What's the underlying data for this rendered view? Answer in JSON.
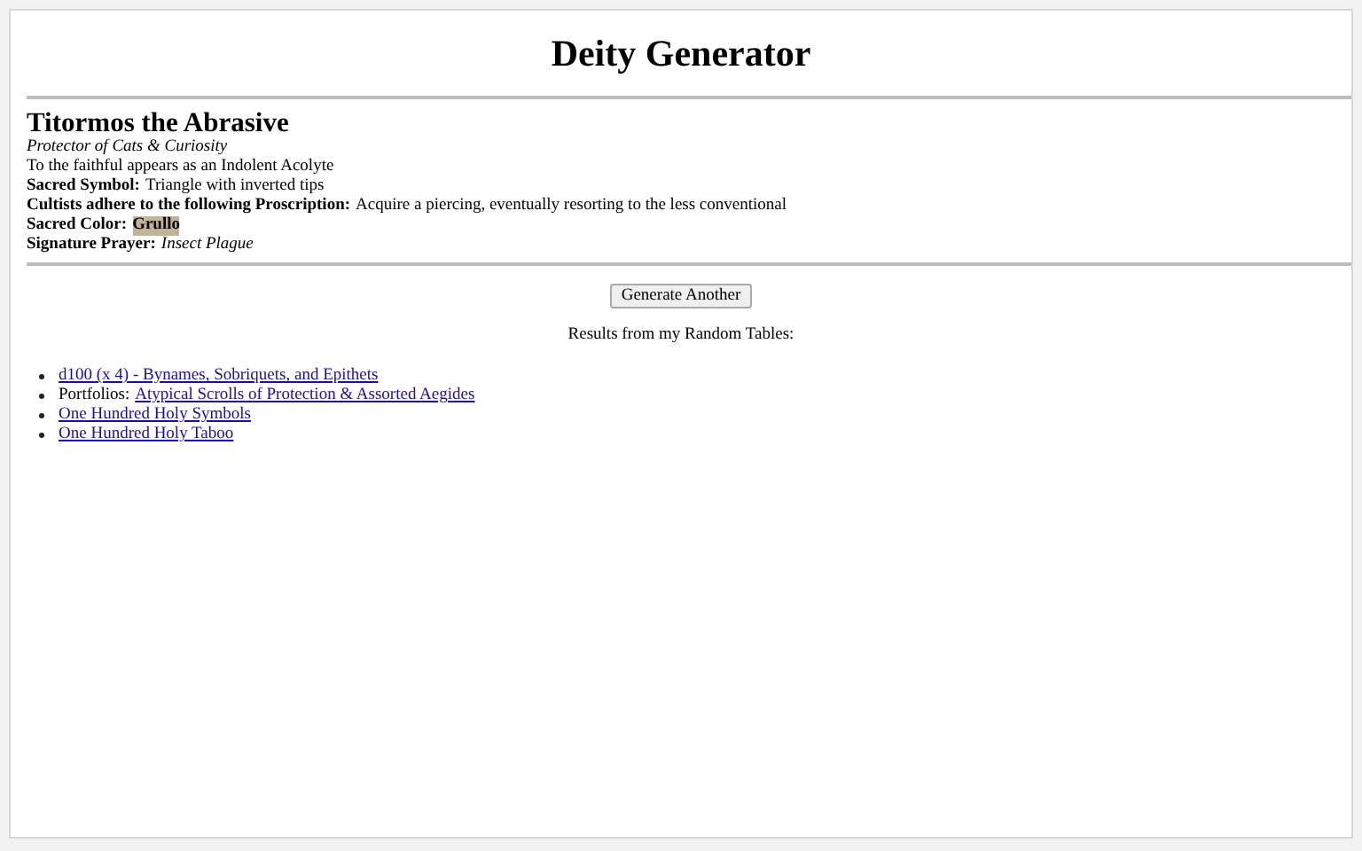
{
  "title": "Deity Generator",
  "deity": {
    "name": "Titormos the Abrasive",
    "epithet": "Protector of Cats & Curiosity",
    "appearance": "To the faithful appears as an Indolent Acolyte",
    "fields": [
      {
        "label": "Sacred Symbol:",
        "value": "Triangle with inverted tips",
        "kind": "text",
        "highlighted": false
      },
      {
        "label": "Cultists adhere to the following Proscription:",
        "value": "Acquire a piercing, eventually resorting to the less conventional",
        "kind": "text",
        "highlighted": false
      },
      {
        "label": "Sacred Color:",
        "value": "Grullo",
        "kind": "color",
        "highlighted": true
      },
      {
        "label": "Signature Prayer:",
        "value": "Insect Plague",
        "kind": "prayer",
        "highlighted": false
      }
    ]
  },
  "button": "Generate Another",
  "results_heading": "Results from my Random Tables:",
  "results": [
    {
      "link": "d100 (x 4) - Bynames, Sobriquets, and Epithets"
    },
    {
      "prefix": "Portfolios:",
      "link": "Atypical Scrolls of Protection & Assorted Aegides"
    },
    {
      "link": "One Hundred Holy Symbols"
    },
    {
      "link": "One Hundred Holy Taboo"
    }
  ]
}
